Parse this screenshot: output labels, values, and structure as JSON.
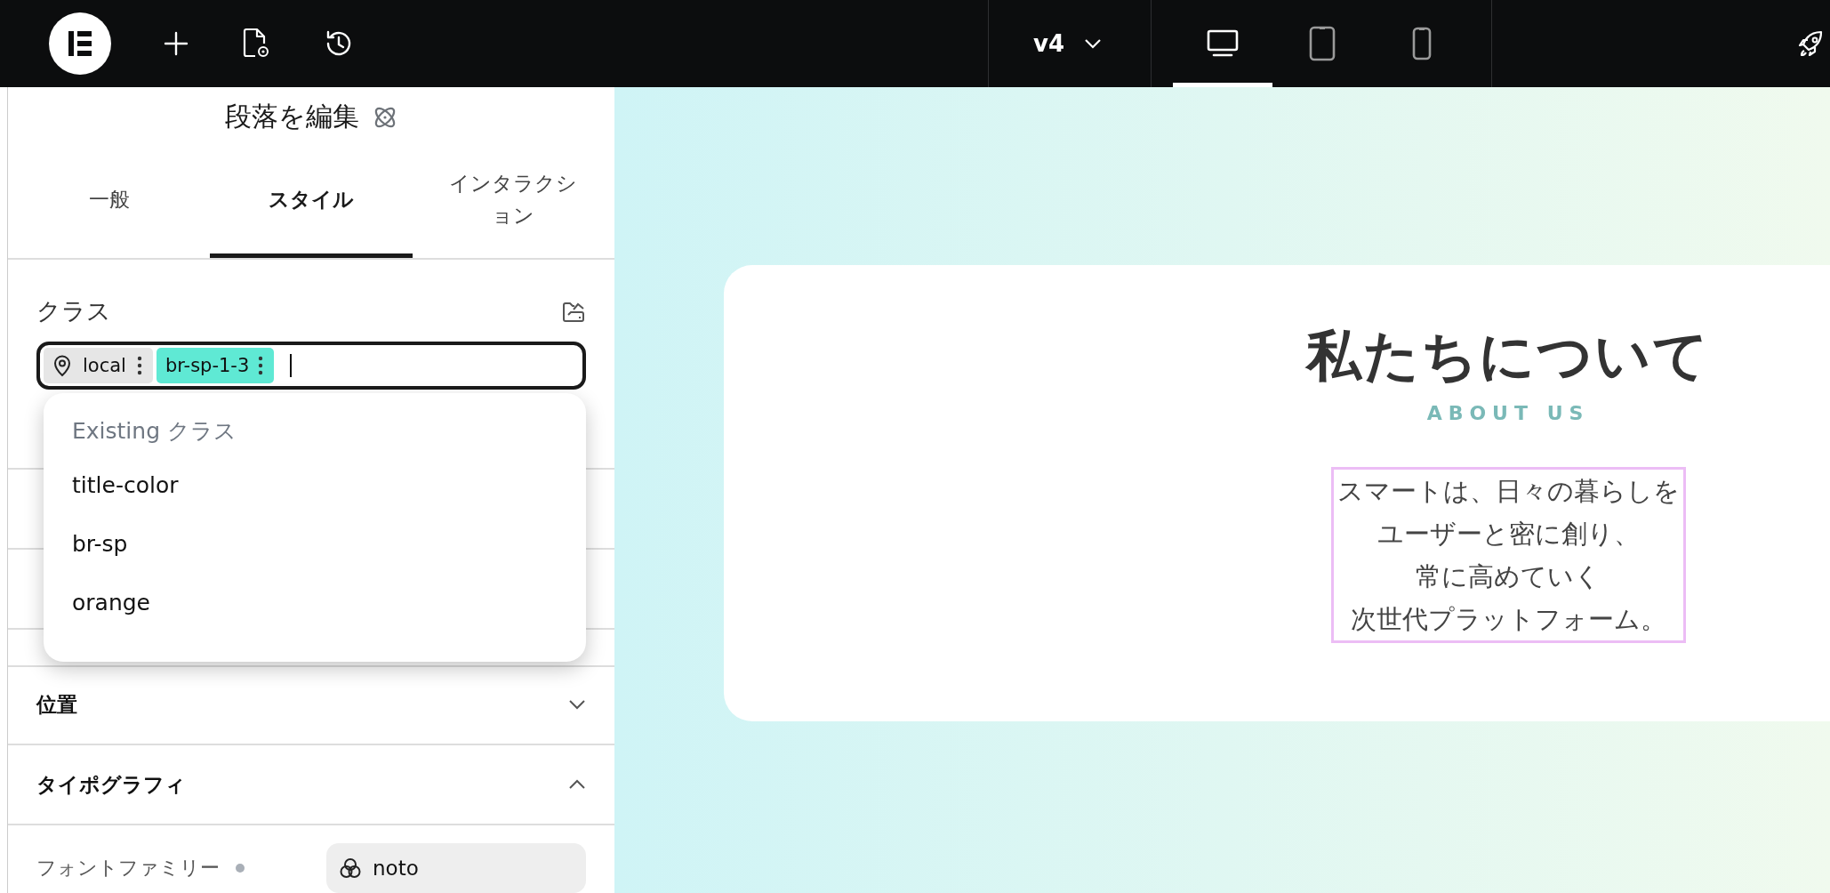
{
  "topbar": {
    "version": "v4",
    "devices": [
      {
        "kind": "desktop",
        "selected": true
      },
      {
        "kind": "tablet",
        "selected": false
      },
      {
        "kind": "mobile",
        "selected": false
      }
    ]
  },
  "panel": {
    "title": "段落を編集",
    "tabs": [
      {
        "label": "一般",
        "selected": false
      },
      {
        "label": "スタイル",
        "selected": true
      },
      {
        "label": "インタラクション",
        "selected": false
      }
    ],
    "classes": {
      "label": "クラス",
      "chips": [
        {
          "kind": "local",
          "label": "local"
        },
        {
          "kind": "class",
          "label": "br-sp-1-3"
        }
      ]
    },
    "dropdown": {
      "heading": "Existing クラス",
      "items": [
        "title-color",
        "br-sp",
        "orange"
      ]
    },
    "sections": [
      {
        "title": "位置",
        "expanded": false
      },
      {
        "title": "タイポグラフィ",
        "expanded": true
      }
    ],
    "font_family": {
      "label": "フォントファミリー",
      "value": "noto"
    }
  },
  "canvas": {
    "heading": "私たちについて",
    "subheading": "ABOUT US",
    "paragraph": {
      "selected": true,
      "lines": [
        "スマートは、日々の暮らしを",
        "ユーザーと密に創り、",
        "常に高めていく",
        "次世代プラットフォーム。"
      ]
    }
  }
}
